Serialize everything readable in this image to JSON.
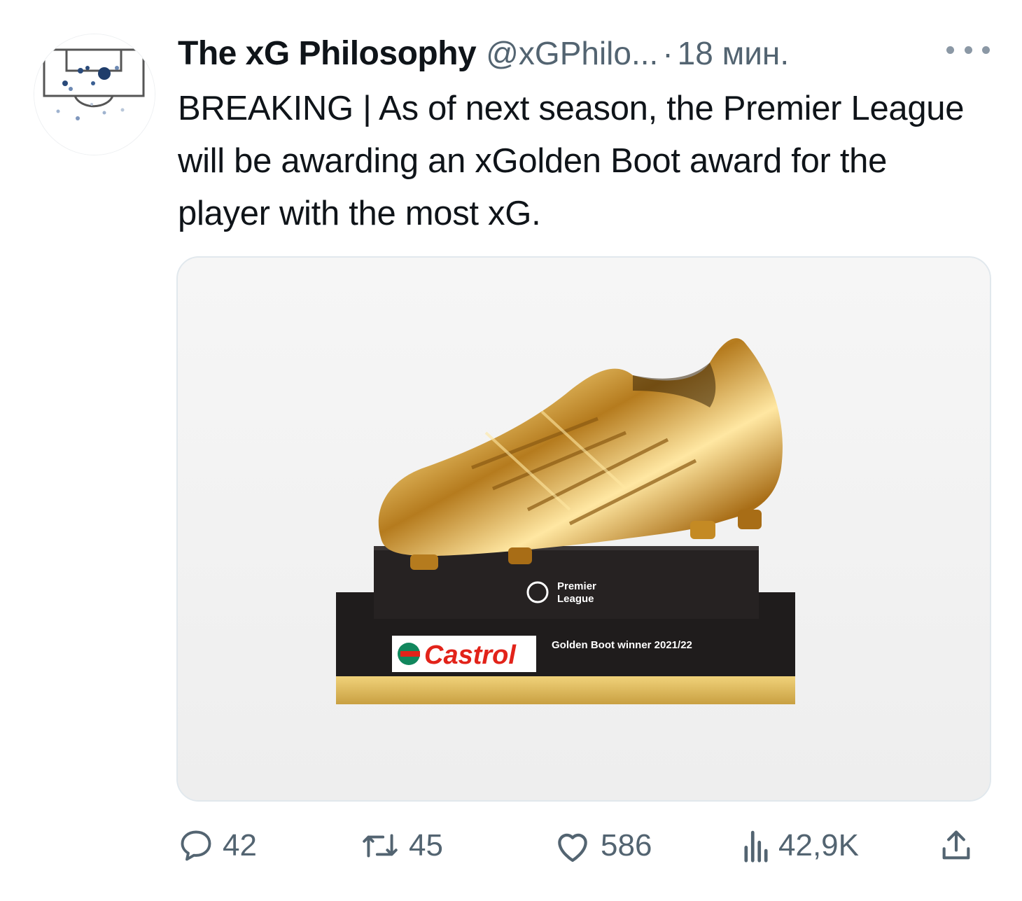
{
  "tweet": {
    "author_name": "The xG Philosophy",
    "handle": "@xGPhilo...",
    "separator": "·",
    "time": "18 мин.",
    "text": "BREAKING | As of next season, the Premier League will be awarding an xGolden Boot award for the player with the most xG."
  },
  "media": {
    "plinth_logo_line1": "Premier",
    "plinth_logo_line2": "League",
    "sponsor": "Castrol",
    "plaque_text": "Golden Boot winner 2021/22"
  },
  "actions": {
    "replies": "42",
    "retweets": "45",
    "likes": "586",
    "views": "42,9K"
  },
  "icons": [
    "more-icon",
    "reply-icon",
    "retweet-icon",
    "like-icon",
    "views-icon",
    "share-icon"
  ],
  "colors": {
    "text": "#0f1419",
    "secondary": "#536471",
    "border": "#e1e8ed",
    "gold": "#d4a22a",
    "avatar_blue": "#2a4a7a"
  }
}
